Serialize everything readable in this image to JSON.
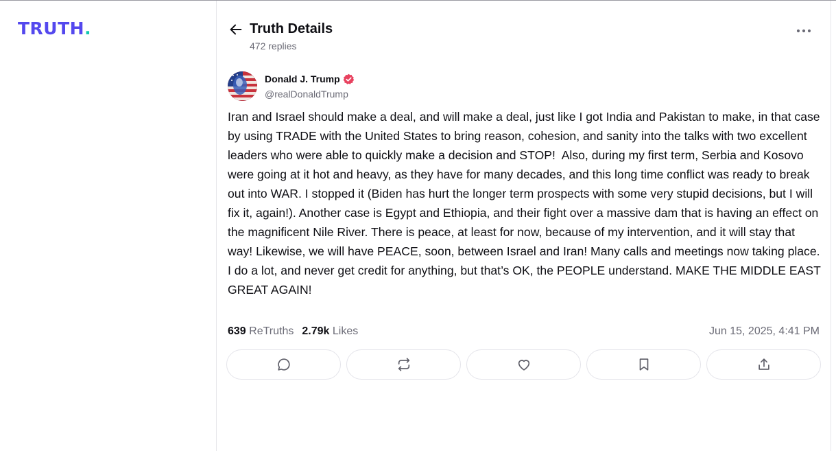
{
  "brand": {
    "logo_text": "TRUTH",
    "logo_dot": ".",
    "logo_color": "#5448ee",
    "dot_color": "#12c8b0"
  },
  "header": {
    "back_icon": "arrow-left-icon",
    "title": "Truth Details",
    "subtitle": "472 replies",
    "more_icon": "more-horizontal-icon"
  },
  "post": {
    "author_name": "Donald J. Trump",
    "verified_icon": "verified-badge-icon",
    "verified_color": "#e8425f",
    "handle": "@realDonaldTrump",
    "text": "Iran and Israel should make a deal, and will make a deal, just like I got India and Pakistan to make, in that case by using TRADE with the United States to bring reason, cohesion, and sanity into the talks with two excellent leaders who were able to quickly make a decision and STOP!  Also, during my first term, Serbia and Kosovo were going at it hot and heavy, as they have for many decades, and this long time conflict was ready to break out into WAR. I stopped it (Biden has hurt the longer term prospects with some very stupid decisions, but I will fix it, again!). Another case is Egypt and Ethiopia, and their fight over a massive dam that is having an effect on the magnificent Nile River. There is peace, at least for now, because of my intervention, and it will stay that way! Likewise, we will have PEACE, soon, between Israel and Iran! Many calls and meetings now taking place. I do a lot, and never get credit for anything, but that’s OK, the PEOPLE understand. MAKE THE MIDDLE EAST GREAT AGAIN!",
    "retruths_count": "639",
    "retruths_label": "ReTruths",
    "likes_count": "2.79k",
    "likes_label": "Likes",
    "timestamp": "Jun 15, 2025, 4:41 PM"
  },
  "actions": [
    {
      "icon": "reply-icon"
    },
    {
      "icon": "retruth-icon"
    },
    {
      "icon": "like-heart-icon"
    },
    {
      "icon": "bookmark-icon"
    },
    {
      "icon": "share-icon"
    }
  ]
}
